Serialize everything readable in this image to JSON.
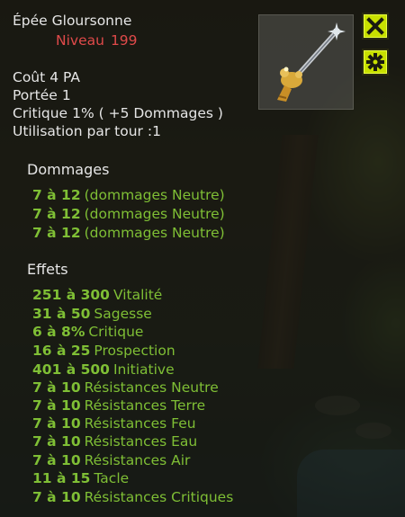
{
  "item": {
    "name": "Épée Gloursonne",
    "level_label": "Niveau",
    "level_value": "199"
  },
  "stats": {
    "cost_label": "Coût",
    "cost_value": "4 PA",
    "range_label": "Portée",
    "range_value": "1",
    "crit_label": "Critique",
    "crit_value": "1% ( +5 Dommages )",
    "uses_label": "Utilisation par tour :",
    "uses_value": "1"
  },
  "damage": {
    "title": "Dommages",
    "lines": [
      {
        "value": "7 à 12",
        "label": "(dommages Neutre)"
      },
      {
        "value": "7 à 12",
        "label": "(dommages Neutre)"
      },
      {
        "value": "7 à 12",
        "label": "(dommages Neutre)"
      }
    ]
  },
  "effects": {
    "title": "Effets",
    "lines": [
      {
        "value": "251 à 300",
        "label": "Vitalité"
      },
      {
        "value": "31 à 50",
        "label": "Sagesse"
      },
      {
        "value": "6 à 8%",
        "label": "Critique"
      },
      {
        "value": "16 à 25",
        "label": "Prospection"
      },
      {
        "value": "401 à 500",
        "label": "Initiative"
      },
      {
        "value": "7 à 10",
        "label": "Résistances Neutre"
      },
      {
        "value": "7 à 10",
        "label": "Résistances Terre"
      },
      {
        "value": "7 à 10",
        "label": "Résistances Feu"
      },
      {
        "value": "7 à 10",
        "label": "Résistances Eau"
      },
      {
        "value": "7 à 10",
        "label": "Résistances Air"
      },
      {
        "value": "11 à 15",
        "label": "Tacle"
      },
      {
        "value": "7 à 10",
        "label": "Résistances Critiques"
      }
    ]
  },
  "colors": {
    "value_green": "#7fbf35",
    "level_red": "#e04a4a",
    "button_yellow": "#c8e000"
  },
  "icons": {
    "close": "close-icon",
    "settings": "gear-icon",
    "item": "sword-icon"
  }
}
